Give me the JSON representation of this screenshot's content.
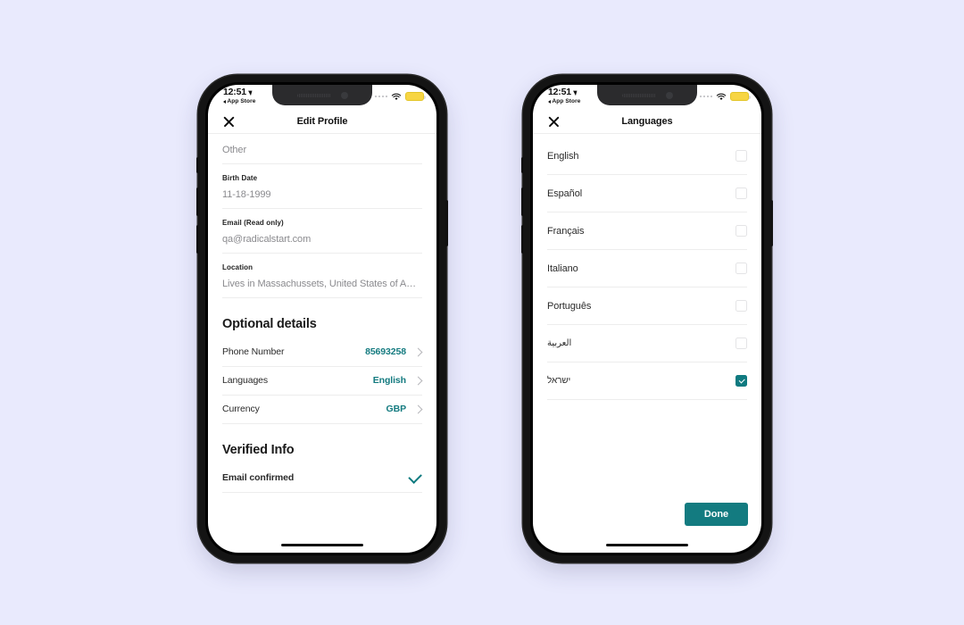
{
  "background_color": "#e9eafd",
  "accent_color": "#137b80",
  "status_bar": {
    "time": "12:51",
    "back_app": "App Store",
    "location_icon": "location-arrow-icon",
    "cellular_icon": "cellular-dots-icon",
    "wifi_icon": "wifi-icon",
    "battery_icon": "battery-low-power-icon"
  },
  "phone_left": {
    "nav": {
      "close_icon": "close-x-icon",
      "title": "Edit Profile"
    },
    "fields": [
      {
        "label": "",
        "value": "Other"
      },
      {
        "label": "Birth Date",
        "value": "11-18-1999"
      },
      {
        "label": "Email (Read only)",
        "value": "qa@radicalstart.com"
      },
      {
        "label": "Location",
        "value": "Lives in Massachussets, United States of Ameri..."
      }
    ],
    "optional_details": {
      "heading": "Optional details",
      "rows": [
        {
          "label": "Phone Number",
          "value": "85693258",
          "chevron": "chevron-right-icon"
        },
        {
          "label": "Languages",
          "value": "English",
          "chevron": "chevron-right-icon"
        },
        {
          "label": "Currency",
          "value": "GBP",
          "chevron": "chevron-right-icon"
        }
      ]
    },
    "verified_info": {
      "heading": "Verified Info",
      "rows": [
        {
          "label": "Email confirmed",
          "icon": "check-mark-icon"
        }
      ]
    }
  },
  "phone_right": {
    "nav": {
      "close_icon": "close-x-icon",
      "title": "Languages"
    },
    "languages": [
      {
        "name": "English",
        "checked": false
      },
      {
        "name": "Español",
        "checked": false
      },
      {
        "name": "Français",
        "checked": false
      },
      {
        "name": "Italiano",
        "checked": false
      },
      {
        "name": "Português",
        "checked": false
      },
      {
        "name": "العربية",
        "checked": false,
        "rtl": true
      },
      {
        "name": "ישראל",
        "checked": true,
        "rtl": true
      }
    ],
    "done_label": "Done"
  }
}
